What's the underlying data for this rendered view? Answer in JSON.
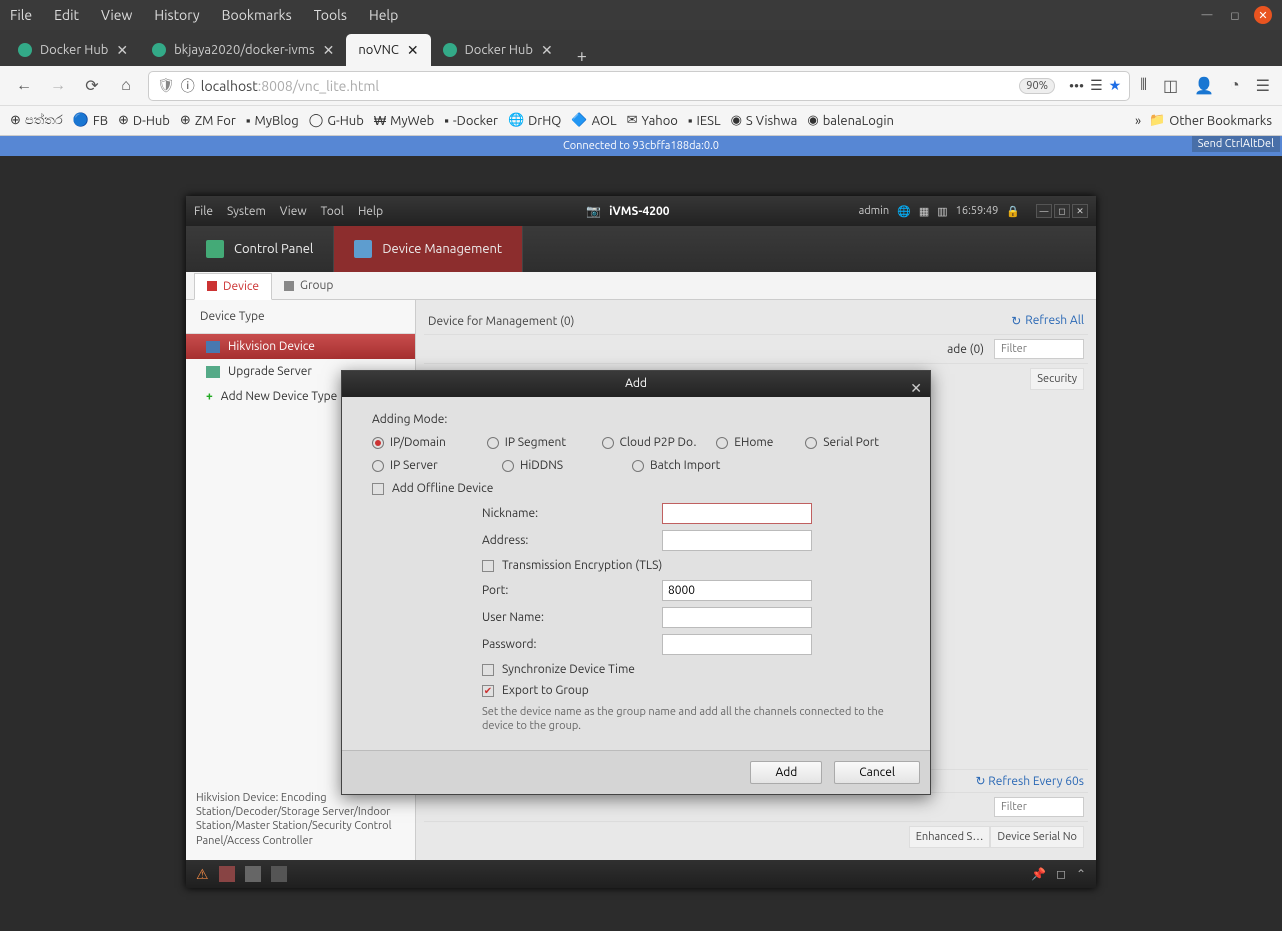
{
  "sysmenu": [
    "File",
    "Edit",
    "View",
    "History",
    "Bookmarks",
    "Tools",
    "Help"
  ],
  "tabs": [
    {
      "title": "Docker Hub",
      "active": false
    },
    {
      "title": "bkjaya2020/docker-ivms",
      "active": false
    },
    {
      "title": "noVNC",
      "active": true
    },
    {
      "title": "Docker Hub",
      "active": false
    }
  ],
  "url": {
    "host": "localhost",
    "port": ":8008",
    "path": "/vnc_lite.html",
    "zoom": "90%"
  },
  "bookmarks": [
    "පත්තර",
    "FB",
    "D-Hub",
    "ZM For",
    "MyBlog",
    "G-Hub",
    "MyWeb",
    "-Docker",
    "DrHQ",
    "AOL",
    "Yahoo",
    "IESL",
    "S Vishwa",
    "balenaLogin"
  ],
  "other_bookmarks": "Other Bookmarks",
  "vnc": {
    "status": "Connected to 93cbffa188da:0.0",
    "button": "Send CtrlAltDel"
  },
  "app": {
    "menu": [
      "File",
      "System",
      "View",
      "Tool",
      "Help"
    ],
    "title": "iVMS-4200",
    "user": "admin",
    "time": "16:59:49",
    "toolbar": [
      {
        "label": "Control Panel"
      },
      {
        "label": "Device Management"
      }
    ],
    "subtabs": [
      {
        "label": "Device"
      },
      {
        "label": "Group"
      }
    ],
    "sidebar": {
      "header": "Device Type",
      "items": [
        {
          "label": "Hikvision Device"
        },
        {
          "label": "Upgrade Server"
        },
        {
          "label": "Add New Device Type"
        }
      ],
      "help": "Hikvision Device: Encoding Station/Decoder/Storage Server/Indoor Station/Master Station/Security Control Panel/Access Controller"
    },
    "main": {
      "title": "Device for Management (0)",
      "refresh": "Refresh All",
      "ade": "ade (0)",
      "filter": "Filter",
      "col": "Security",
      "refreshEvery": "Refresh Every 60s",
      "filter2": "Filter",
      "cols": [
        "Enhanced S…",
        "Device Serial No"
      ]
    }
  },
  "modal": {
    "title": "Add",
    "adding_label": "Adding Mode:",
    "radios1": [
      "IP/Domain",
      "IP Segment",
      "Cloud P2P Do…",
      "EHome",
      "Serial Port"
    ],
    "radios2": [
      "IP Server",
      "HiDDNS",
      "Batch Import"
    ],
    "offline": "Add Offline Device",
    "fields": {
      "nickname": "Nickname:",
      "address": "Address:",
      "tls": "Transmission Encryption (TLS)",
      "port_label": "Port:",
      "port_value": "8000",
      "username": "User Name:",
      "password": "Password:",
      "sync": "Synchronize Device Time",
      "export": "Export to Group",
      "hint": "Set the device name as the group name and add all the channels connected to the device to the group."
    },
    "add_btn": "Add",
    "cancel_btn": "Cancel"
  }
}
